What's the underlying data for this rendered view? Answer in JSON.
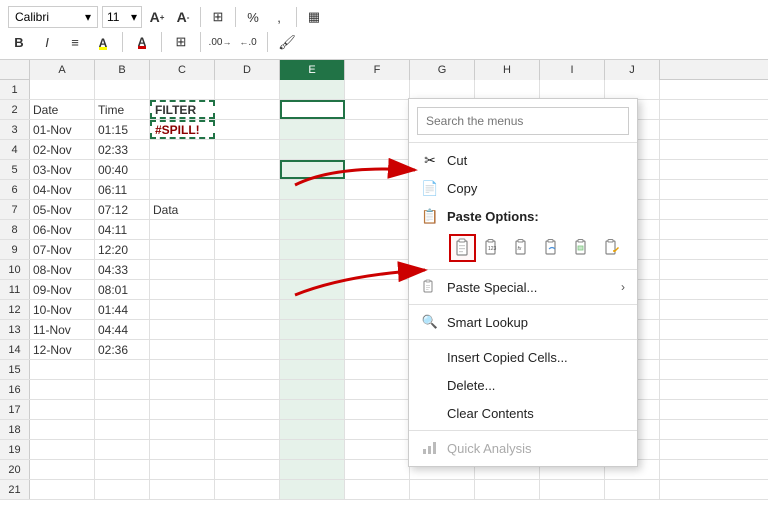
{
  "ribbon": {
    "font_name": "Calibri",
    "font_size": "11",
    "bold": "B",
    "italic": "I",
    "align": "≡",
    "highlight": "A",
    "font_color": "A",
    "borders": "⊞",
    "percent": "%",
    "comma": ",",
    "increase_decimal": "+0",
    "decrease_decimal": "-0",
    "format": "▦"
  },
  "columns": [
    "A",
    "B",
    "C",
    "D",
    "E",
    "F",
    "G",
    "H",
    "I",
    "J"
  ],
  "col_widths": [
    "w-a",
    "w-b",
    "w-c",
    "w-d",
    "w-e",
    "w-f",
    "w-g",
    "w-h",
    "w-i",
    "w-j"
  ],
  "rows": [
    {
      "num": "1",
      "cells": [
        "",
        "",
        "",
        "",
        "",
        "",
        "",
        "",
        "",
        ""
      ]
    },
    {
      "num": "2",
      "cells": [
        "Date",
        "Time",
        "FILTER",
        "",
        "",
        "",
        "",
        "",
        "",
        ""
      ]
    },
    {
      "num": "3",
      "cells": [
        "01-Nov",
        "01:15",
        "#SPILL!",
        "",
        "",
        "",
        "",
        "",
        "",
        ""
      ]
    },
    {
      "num": "4",
      "cells": [
        "02-Nov",
        "02:33",
        "",
        "",
        "",
        "",
        "",
        "",
        "",
        ""
      ]
    },
    {
      "num": "5",
      "cells": [
        "03-Nov",
        "00:40",
        "",
        "",
        "",
        "",
        "",
        "",
        "",
        ""
      ]
    },
    {
      "num": "6",
      "cells": [
        "04-Nov",
        "06:11",
        "",
        "",
        "",
        "",
        "",
        "",
        "",
        ""
      ]
    },
    {
      "num": "7",
      "cells": [
        "05-Nov",
        "07:12",
        "Data",
        "",
        "",
        "",
        "",
        "",
        "",
        ""
      ]
    },
    {
      "num": "8",
      "cells": [
        "06-Nov",
        "04:11",
        "",
        "",
        "",
        "",
        "",
        "",
        "",
        ""
      ]
    },
    {
      "num": "9",
      "cells": [
        "07-Nov",
        "12:20",
        "",
        "",
        "",
        "",
        "",
        "",
        "",
        ""
      ]
    },
    {
      "num": "10",
      "cells": [
        "08-Nov",
        "04:33",
        "",
        "",
        "",
        "",
        "",
        "",
        "",
        ""
      ]
    },
    {
      "num": "11",
      "cells": [
        "09-Nov",
        "08:01",
        "",
        "",
        "",
        "",
        "",
        "",
        "",
        ""
      ]
    },
    {
      "num": "12",
      "cells": [
        "10-Nov",
        "01:44",
        "",
        "",
        "",
        "",
        "",
        "",
        "",
        ""
      ]
    },
    {
      "num": "13",
      "cells": [
        "11-Nov",
        "04:44",
        "",
        "",
        "",
        "",
        "",
        "",
        "",
        ""
      ]
    },
    {
      "num": "14",
      "cells": [
        "12-Nov",
        "02:36",
        "",
        "",
        "",
        "",
        "",
        "",
        "",
        ""
      ]
    },
    {
      "num": "15",
      "cells": [
        "",
        "",
        "",
        "",
        "",
        "",
        "",
        "",
        "",
        ""
      ]
    },
    {
      "num": "16",
      "cells": [
        "",
        "",
        "",
        "",
        "",
        "",
        "",
        "",
        "",
        ""
      ]
    },
    {
      "num": "17",
      "cells": [
        "",
        "",
        "",
        "",
        "",
        "",
        "",
        "",
        "",
        ""
      ]
    },
    {
      "num": "18",
      "cells": [
        "",
        "",
        "",
        "",
        "",
        "",
        "",
        "",
        "",
        ""
      ]
    },
    {
      "num": "19",
      "cells": [
        "",
        "",
        "",
        "",
        "",
        "",
        "",
        "",
        "",
        ""
      ]
    },
    {
      "num": "20",
      "cells": [
        "",
        "",
        "",
        "",
        "",
        "",
        "",
        "",
        "",
        ""
      ]
    },
    {
      "num": "21",
      "cells": [
        "",
        "",
        "",
        "",
        "",
        "",
        "",
        "",
        "",
        ""
      ]
    }
  ],
  "context_menu": {
    "search_placeholder": "Search the menus",
    "items": [
      {
        "label": "Cut",
        "icon": "cut",
        "disabled": false,
        "submenu": false
      },
      {
        "label": "Copy",
        "icon": "copy",
        "disabled": false,
        "submenu": false
      },
      {
        "label": "Paste Options:",
        "icon": "paste",
        "disabled": false,
        "submenu": false,
        "is_paste_header": true
      },
      {
        "label": "Paste Special...",
        "icon": "paste-special",
        "disabled": false,
        "submenu": true
      },
      {
        "label": "Smart Lookup",
        "icon": "magnifier",
        "disabled": false,
        "submenu": false
      },
      {
        "label": "Insert Copied Cells...",
        "icon": "",
        "disabled": false,
        "submenu": false
      },
      {
        "label": "Delete...",
        "icon": "",
        "disabled": false,
        "submenu": false
      },
      {
        "label": "Clear Contents",
        "icon": "",
        "disabled": false,
        "submenu": false
      },
      {
        "label": "Quick Analysis",
        "icon": "chart",
        "disabled": true,
        "submenu": false
      }
    ],
    "paste_options_tooltip": "Paste Options"
  },
  "colors": {
    "excel_green": "#217346",
    "spill_red": "#8B0000",
    "red_arrow": "#cc0000",
    "selected_col_bg": "#e6f2ea"
  }
}
